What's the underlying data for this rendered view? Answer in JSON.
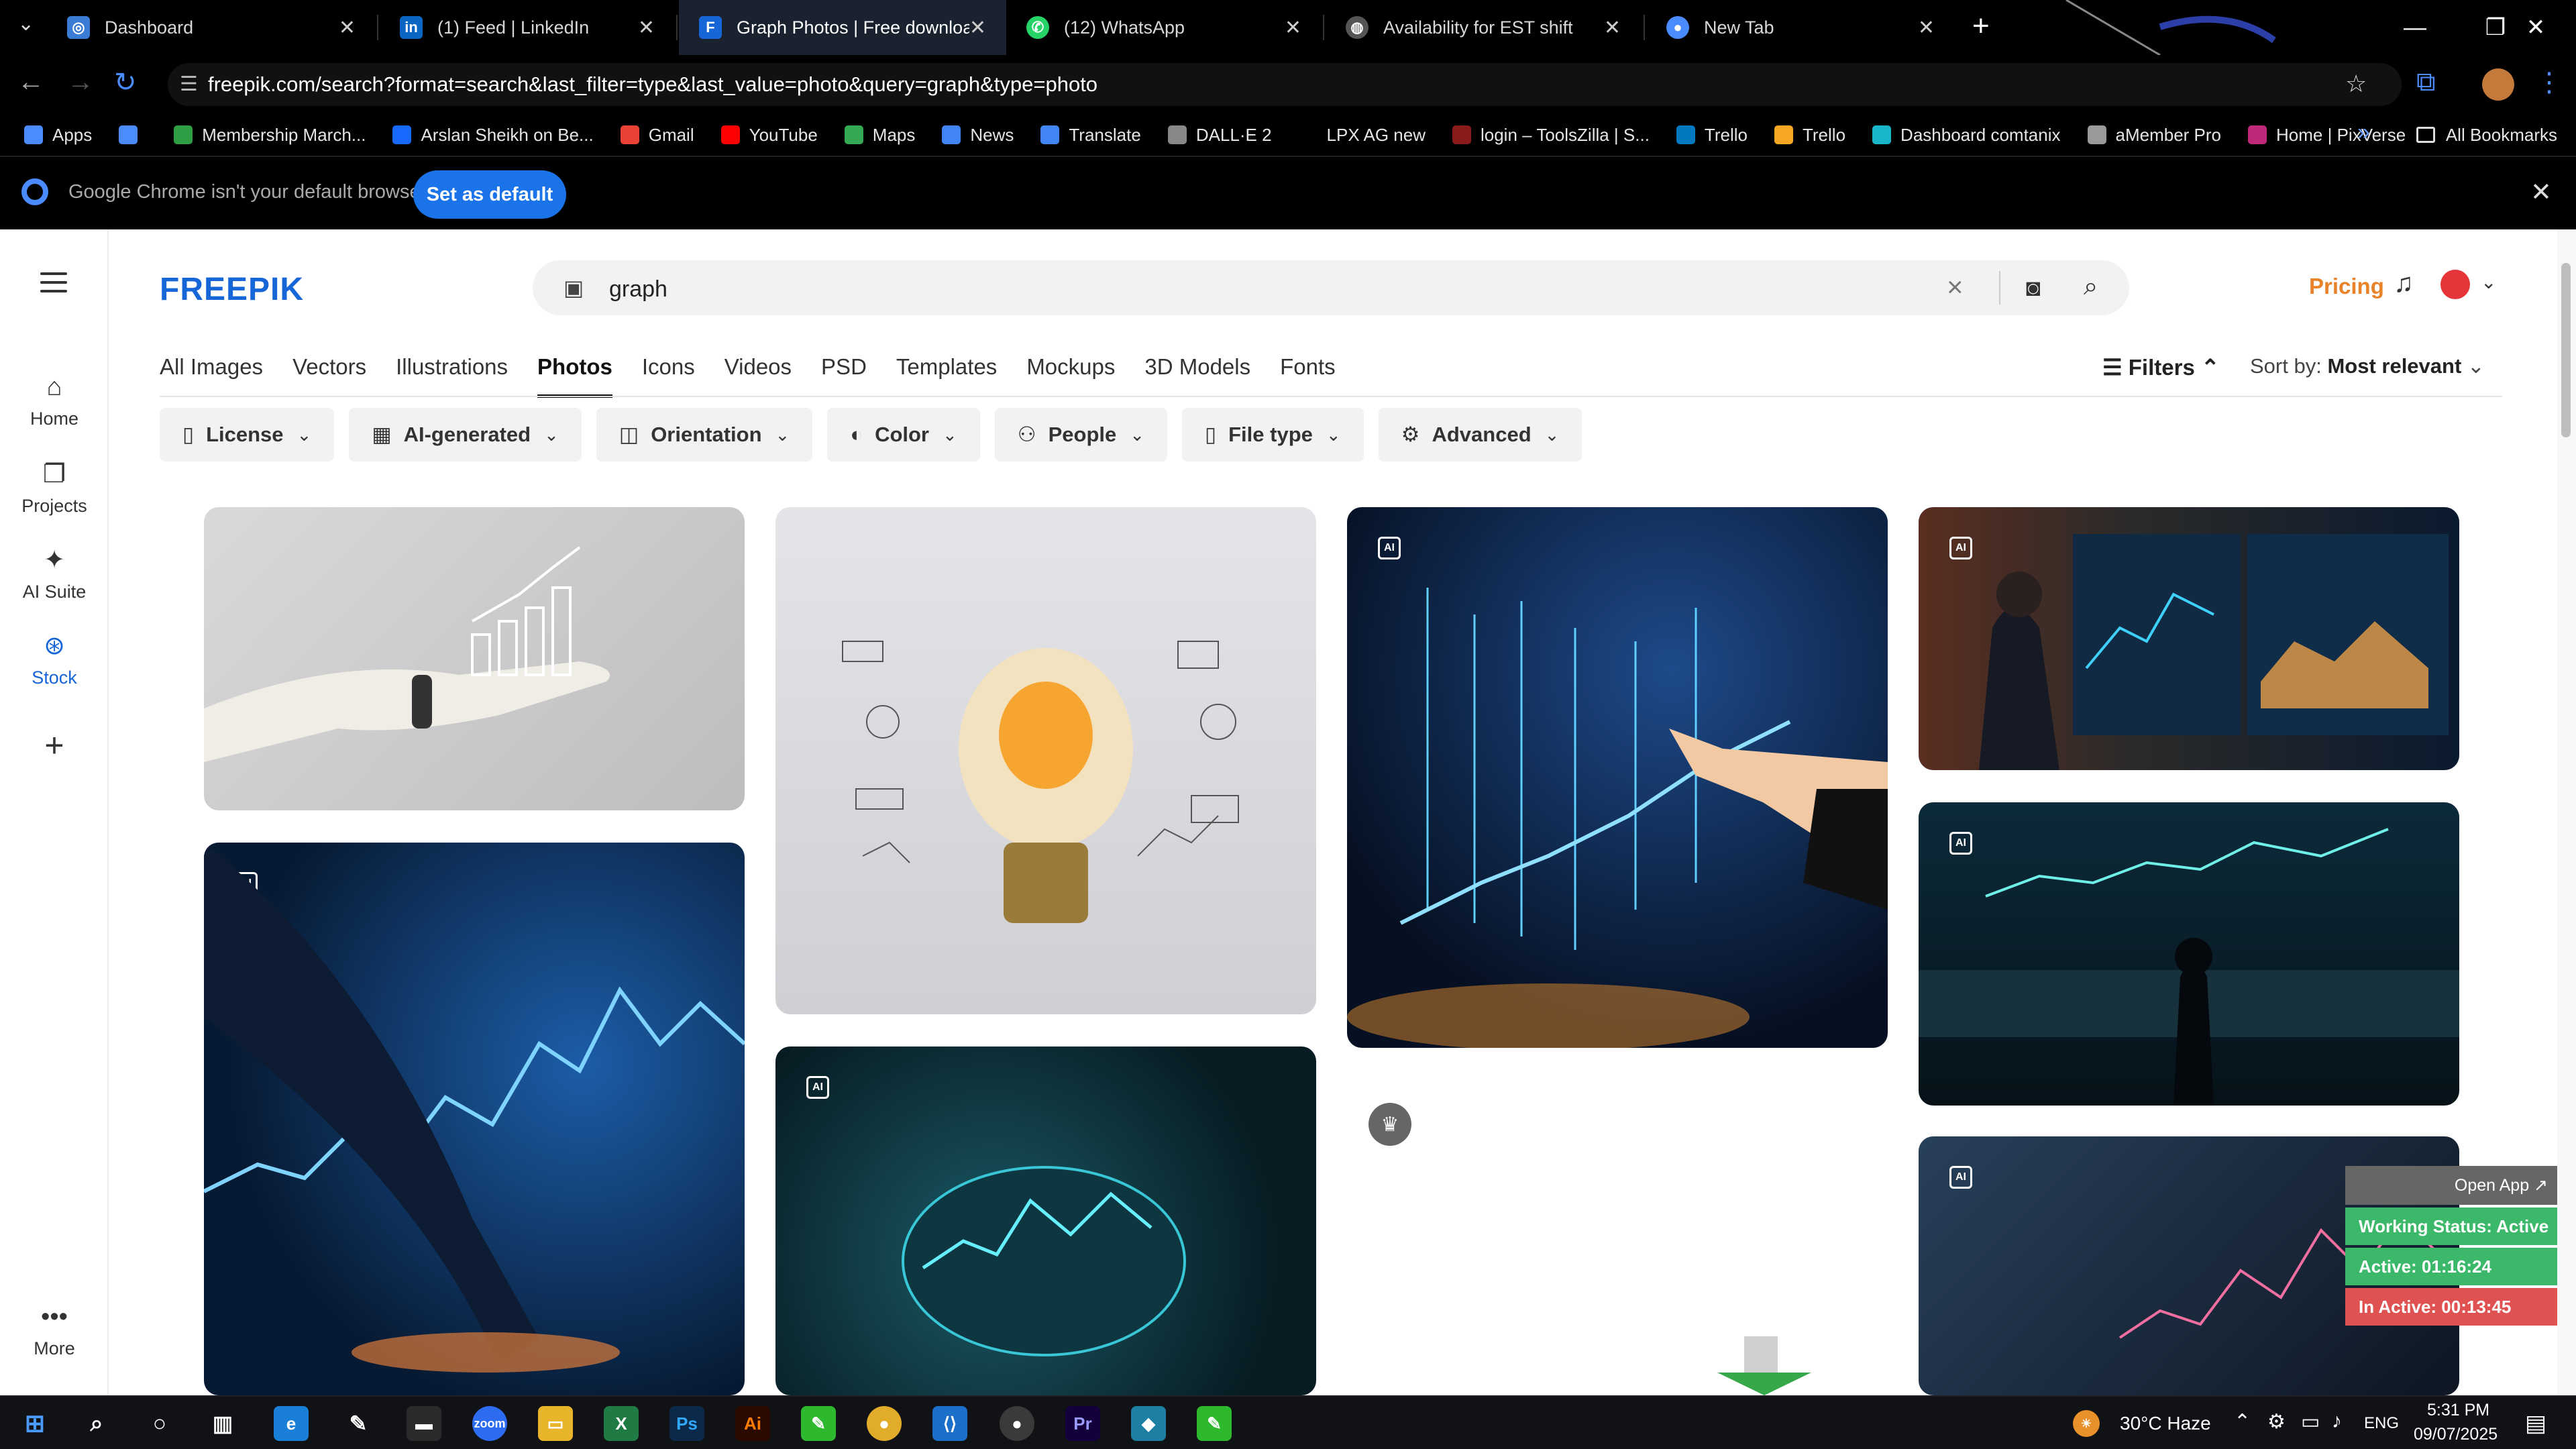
{
  "browser": {
    "tabs": [
      {
        "title": "Dashboard",
        "icon": "globe-icon",
        "color": "#3a7bd5"
      },
      {
        "title": "(1) Feed | LinkedIn",
        "icon": "linkedin-icon",
        "color": "#0a66c2"
      },
      {
        "title": "Graph Photos | Free download",
        "icon": "freepik-icon",
        "color": "#1766d8"
      },
      {
        "title": "(12) WhatsApp",
        "icon": "whatsapp-icon",
        "color": "#25d366"
      },
      {
        "title": "Availability for EST shift",
        "icon": "globe-icon",
        "color": "#888888"
      },
      {
        "title": "New Tab",
        "icon": "chrome-icon",
        "color": "#4a8cff"
      }
    ],
    "url": "freepik.com/search?format=search&last_filter=type&last_value=photo&query=graph&type=photo",
    "bookmarks": [
      {
        "label": "Apps",
        "color": "#4a8cff"
      },
      {
        "label": "",
        "color": "#4a8cff"
      },
      {
        "label": "Membership March...",
        "color": "#2e9e44"
      },
      {
        "label": "Arslan Sheikh on Be...",
        "color": "#1769ff"
      },
      {
        "label": "Gmail",
        "color": "#ea4335"
      },
      {
        "label": "YouTube",
        "color": "#ff0000"
      },
      {
        "label": "Maps",
        "color": "#34a853"
      },
      {
        "label": "News",
        "color": "#4285f4"
      },
      {
        "label": "Translate",
        "color": "#4285f4"
      },
      {
        "label": "DALL·E 2",
        "color": "#888888"
      },
      {
        "label": "LPX AG new",
        "color": "#000000"
      },
      {
        "label": "login – ToolsZilla | S...",
        "color": "#8b1a1a"
      },
      {
        "label": "Trello",
        "color": "#0079bf"
      },
      {
        "label": "Trello",
        "color": "#f5a623"
      },
      {
        "label": "Dashboard comtanix",
        "color": "#19b5c9"
      },
      {
        "label": "aMember Pro",
        "color": "#999999"
      },
      {
        "label": "Home | PixVerse",
        "color": "#c0297a"
      }
    ],
    "all_bookmarks": "All Bookmarks",
    "infobar": {
      "message": "Google Chrome isn't your default browser",
      "button": "Set as default"
    }
  },
  "sidebar": {
    "items": [
      {
        "label": "Home",
        "icon": "home-icon"
      },
      {
        "label": "Projects",
        "icon": "projects-icon"
      },
      {
        "label": "AI Suite",
        "icon": "sparkle-icon"
      },
      {
        "label": "Stock",
        "icon": "stock-icon"
      },
      {
        "label": "",
        "icon": "plus-icon"
      },
      {
        "label": "More",
        "icon": "more-icon"
      }
    ]
  },
  "header": {
    "logo": "FREEPIK",
    "search_query": "graph",
    "pricing": "Pricing"
  },
  "categories": [
    "All Images",
    "Vectors",
    "Illustrations",
    "Photos",
    "Icons",
    "Videos",
    "PSD",
    "Templates",
    "Mockups",
    "3D Models",
    "Fonts"
  ],
  "active_category": "Photos",
  "filters_label": "Filters",
  "sort": {
    "label": "Sort by:",
    "value": "Most relevant"
  },
  "chips": [
    {
      "label": "License",
      "icon": "file-icon"
    },
    {
      "label": "AI-generated",
      "icon": "ai-icon"
    },
    {
      "label": "Orientation",
      "icon": "orientation-icon"
    },
    {
      "label": "Color",
      "icon": "palette-icon"
    },
    {
      "label": "People",
      "icon": "people-icon"
    },
    {
      "label": "File type",
      "icon": "file-icon"
    },
    {
      "label": "Advanced",
      "icon": "gear-icon"
    }
  ],
  "widget": {
    "open_app": "Open App ↗",
    "working_status": "Working Status: Active",
    "active": "Active: 01:16:24",
    "inactive": "In Active: 00:13:45"
  },
  "taskbar": {
    "weather": "30°C  Haze",
    "lang": "ENG",
    "time": "5:31 PM",
    "date": "09/07/2025"
  },
  "colors": {
    "brand": "#1766d8",
    "pricing": "#e8832a",
    "widget_green": "#3cb86a",
    "widget_red": "#e05252"
  }
}
